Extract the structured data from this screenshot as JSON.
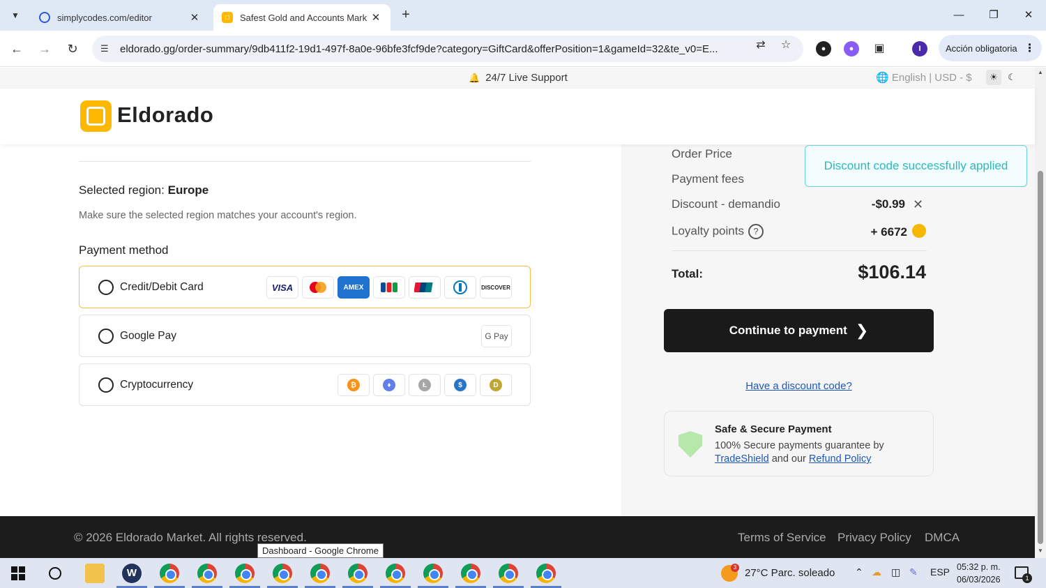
{
  "browser": {
    "tabs": [
      {
        "title": "simplycodes.com/editor",
        "active": false
      },
      {
        "title": "Safest Gold and Accounts Mark",
        "active": true
      }
    ],
    "url": "eldorado.gg/order-summary/9db411f2-19d1-497f-8a0e-96bfe3fcf9de?category=GiftCard&offerPosition=1&gameId=32&te_v0=E...",
    "profile_initial": "I",
    "profile_label": "Acción obligatoria"
  },
  "topbar": {
    "support": "24/7 Live Support",
    "language": "English | USD - $"
  },
  "header": {
    "brand": "Eldorado"
  },
  "region": {
    "label": "Selected region:",
    "value": "Europe",
    "note": "Make sure the selected region matches your account's region."
  },
  "payment": {
    "title": "Payment method",
    "options": [
      {
        "label": "Credit/Debit Card",
        "selected": true,
        "logos": [
          "VISA",
          "Mastercard",
          "AMEX",
          "JCB",
          "UnionPay",
          "Diners",
          "DISCOVER"
        ]
      },
      {
        "label": "Google Pay",
        "selected": false,
        "logos": [
          "G Pay"
        ]
      },
      {
        "label": "Cryptocurrency",
        "selected": false,
        "logos": [
          "bitcoin",
          "ethereum",
          "litecoin",
          "usdc",
          "dogecoin"
        ]
      }
    ]
  },
  "summary": {
    "order_price_label": "Order Price",
    "payment_fees_label": "Payment fees",
    "discount_label": "Discount - demandio",
    "discount_value": "-$0.99",
    "loyalty_label": "Loyalty points",
    "loyalty_value": "+ 6672",
    "total_label": "Total:",
    "total_value": "$106.14",
    "continue_label": "Continue to payment",
    "discount_link": "Have a discount code?",
    "secure_title": "Safe & Secure Payment",
    "secure_text": "100% Secure payments guarantee by",
    "tradeshield": "TradeShield",
    "and_our": "and our",
    "refund_policy": "Refund Policy"
  },
  "toast": {
    "message": "Discount code successfully applied"
  },
  "footer": {
    "copyright": "© 2026 Eldorado Market. All rights reserved.",
    "links": [
      "Terms of Service",
      "Privacy Policy",
      "DMCA"
    ]
  },
  "tooltip": "Dashboard - Google Chrome",
  "taskbar": {
    "weather_badge": "3",
    "weather": "27°C  Parc. soleado",
    "language": "ESP",
    "time": "05:32 p. m.",
    "date": "06/03/2026",
    "notifications": "1"
  },
  "colors": {
    "brand": "#ffb800",
    "toast_text": "#2bb8c1",
    "link": "#1d57b8",
    "button": "#1a1a1a"
  }
}
